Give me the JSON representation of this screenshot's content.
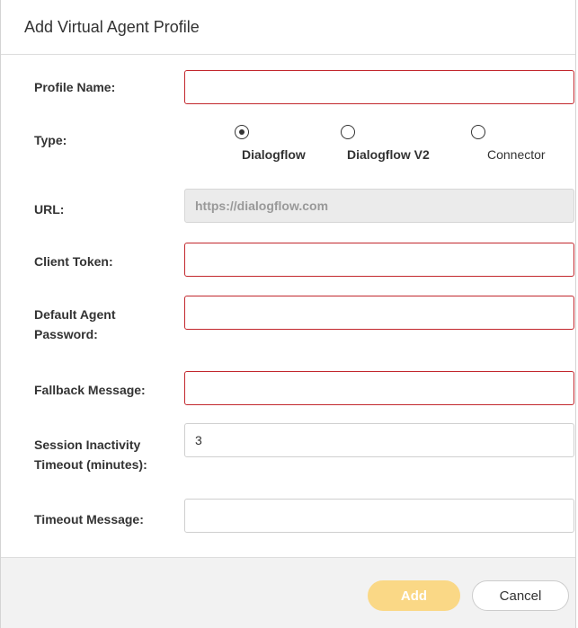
{
  "dialog": {
    "title": "Add Virtual Agent Profile"
  },
  "form": {
    "profile_name": {
      "label": "Profile Name:",
      "value": ""
    },
    "type": {
      "label": "Type:",
      "options": [
        {
          "label": "Dialogflow",
          "selected": true
        },
        {
          "label": "Dialogflow V2",
          "selected": false
        },
        {
          "label": "Connector",
          "selected": false
        }
      ]
    },
    "url": {
      "label": "URL:",
      "value": "https://dialogflow.com"
    },
    "client_token": {
      "label": "Client Token:",
      "value": ""
    },
    "default_agent_password": {
      "label_line1": "Default Agent",
      "label_line2": "Password:",
      "value": ""
    },
    "fallback_message": {
      "label": "Fallback Message:",
      "value": ""
    },
    "session_inactivity_timeout": {
      "label_line1": "Session Inactivity",
      "label_line2": "Timeout (minutes):",
      "value": "3"
    },
    "timeout_message": {
      "label": "Timeout Message:",
      "value": ""
    }
  },
  "footer": {
    "add_label": "Add",
    "cancel_label": "Cancel"
  },
  "colors": {
    "required_border": "#c2272d",
    "add_button_bg": "#fad886",
    "footer_bg": "#f2f2f2",
    "disabled_input_bg": "#ebebeb"
  }
}
